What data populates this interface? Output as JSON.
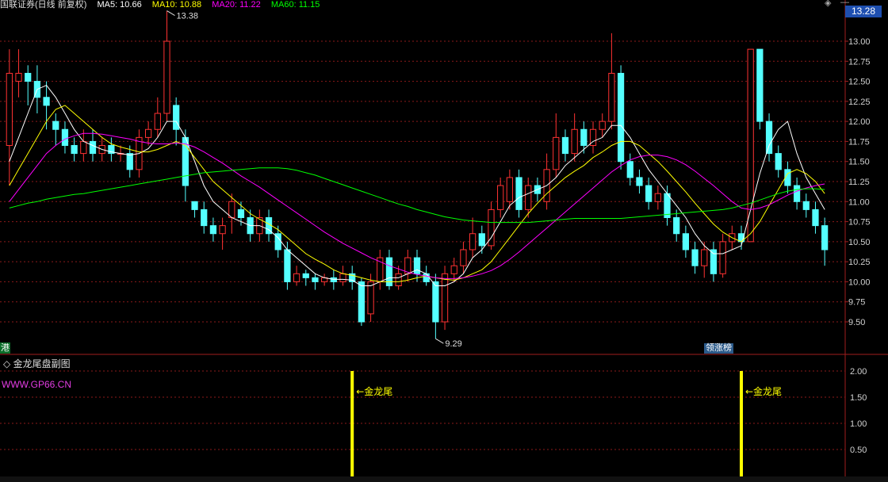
{
  "header": {
    "stock_name": "国联证券(日线 前复权)",
    "ma5": "MA5: 10.66",
    "ma10": "MA10: 10.88",
    "ma20": "MA20: 11.22",
    "ma60": "MA60: 11.15"
  },
  "current_price": "13.28",
  "high_label": "13.38",
  "low_label": "9.29",
  "left_tag": "港",
  "zt_tag": "领涨榜",
  "sub_title": "金龙尾盘副图",
  "sub_url": "WWW.GP66.CN",
  "signal_label": "←金龙尾",
  "colors": {
    "up": "#ff3232",
    "down": "#54ffff",
    "ma5": "#ffffff",
    "ma10": "#ffff00",
    "ma20": "#ff00ff",
    "ma60": "#00ff00",
    "signal": "#ffff00",
    "grid": "#8b1a1a"
  },
  "chart_data": [
    {
      "type": "candlestick",
      "title": "国联证券(日线 前复权)",
      "y_ticks": [
        "13.00",
        "12.75",
        "12.50",
        "12.25",
        "12.00",
        "11.75",
        "11.50",
        "11.25",
        "11.00",
        "10.75",
        "10.50",
        "10.25",
        "10.00",
        "9.75",
        "9.50"
      ],
      "ylim": [
        9.2,
        13.45
      ],
      "high": 13.38,
      "low": 9.29,
      "candles": [
        [
          11.7,
          12.6,
          11.2,
          12.9
        ],
        [
          12.5,
          12.6,
          12.3,
          12.9
        ],
        [
          12.6,
          12.5,
          12.2,
          12.7
        ],
        [
          12.5,
          12.3,
          12.1,
          12.7
        ],
        [
          12.3,
          12.2,
          11.9,
          12.5
        ],
        [
          12.0,
          11.9,
          11.7,
          12.1
        ],
        [
          11.9,
          11.7,
          11.6,
          12.0
        ],
        [
          11.7,
          11.6,
          11.5,
          11.8
        ],
        [
          11.6,
          11.75,
          11.5,
          11.9
        ],
        [
          11.75,
          11.6,
          11.5,
          11.9
        ],
        [
          11.6,
          11.7,
          11.5,
          11.8
        ],
        [
          11.7,
          11.6,
          11.5,
          11.8
        ],
        [
          11.6,
          11.6,
          11.5,
          11.7
        ],
        [
          11.6,
          11.4,
          11.3,
          11.7
        ],
        [
          11.4,
          11.8,
          11.3,
          11.9
        ],
        [
          11.8,
          11.9,
          11.7,
          12.0
        ],
        [
          11.9,
          12.1,
          11.8,
          12.3
        ],
        [
          12.1,
          13.0,
          12.0,
          13.38
        ],
        [
          12.2,
          11.9,
          11.7,
          12.3
        ],
        [
          11.8,
          11.2,
          11.0,
          11.9
        ],
        [
          11.0,
          10.9,
          10.8,
          11.0
        ],
        [
          10.9,
          10.7,
          10.6,
          11.0
        ],
        [
          10.7,
          10.6,
          10.5,
          10.8
        ],
        [
          10.6,
          10.7,
          10.4,
          10.8
        ],
        [
          10.8,
          11.0,
          10.6,
          11.1
        ],
        [
          10.9,
          10.8,
          10.7,
          11.0
        ],
        [
          10.8,
          10.6,
          10.5,
          10.9
        ],
        [
          10.6,
          10.8,
          10.5,
          10.9
        ],
        [
          10.8,
          10.6,
          10.5,
          10.9
        ],
        [
          10.6,
          10.4,
          10.3,
          10.7
        ],
        [
          10.4,
          10.0,
          9.9,
          10.5
        ],
        [
          10.0,
          10.1,
          9.95,
          10.2
        ],
        [
          10.1,
          10.05,
          9.95,
          10.15
        ],
        [
          10.05,
          10.0,
          9.9,
          10.1
        ],
        [
          10.0,
          10.05,
          9.95,
          10.1
        ],
        [
          10.05,
          10.0,
          9.9,
          10.15
        ],
        [
          10.0,
          10.1,
          9.95,
          10.2
        ],
        [
          10.1,
          10.0,
          9.9,
          10.2
        ],
        [
          10.0,
          9.5,
          9.45,
          10.05
        ],
        [
          9.6,
          10.0,
          9.5,
          10.1
        ],
        [
          10.0,
          10.3,
          9.9,
          10.4
        ],
        [
          10.3,
          9.95,
          9.9,
          10.4
        ],
        [
          9.95,
          10.1,
          9.9,
          10.2
        ],
        [
          10.1,
          10.3,
          10.0,
          10.4
        ],
        [
          10.3,
          10.1,
          10.0,
          10.4
        ],
        [
          10.1,
          10.0,
          9.95,
          10.2
        ],
        [
          10.0,
          9.5,
          9.29,
          10.1
        ],
        [
          9.5,
          10.1,
          9.4,
          10.2
        ],
        [
          10.1,
          10.2,
          10.0,
          10.3
        ],
        [
          10.2,
          10.4,
          10.1,
          10.5
        ],
        [
          10.4,
          10.6,
          10.3,
          10.8
        ],
        [
          10.6,
          10.45,
          10.35,
          10.7
        ],
        [
          10.45,
          10.9,
          10.4,
          11.0
        ],
        [
          10.9,
          11.2,
          10.8,
          11.3
        ],
        [
          11.0,
          11.3,
          10.9,
          11.4
        ],
        [
          11.3,
          10.9,
          10.8,
          11.4
        ],
        [
          10.9,
          11.2,
          10.8,
          11.3
        ],
        [
          11.2,
          11.1,
          11.0,
          11.3
        ],
        [
          11.0,
          11.4,
          10.9,
          11.6
        ],
        [
          11.4,
          11.8,
          11.3,
          12.1
        ],
        [
          11.8,
          11.6,
          11.5,
          11.9
        ],
        [
          11.6,
          11.9,
          11.5,
          12.1
        ],
        [
          11.9,
          11.7,
          11.6,
          12.0
        ],
        [
          11.7,
          11.9,
          11.6,
          12.0
        ],
        [
          11.9,
          12.0,
          11.8,
          12.1
        ],
        [
          12.0,
          12.6,
          11.9,
          13.1
        ],
        [
          12.6,
          11.5,
          11.4,
          12.7
        ],
        [
          11.5,
          11.3,
          11.2,
          11.6
        ],
        [
          11.3,
          11.2,
          11.1,
          11.4
        ],
        [
          11.2,
          11.0,
          10.9,
          11.3
        ],
        [
          11.0,
          11.1,
          10.9,
          11.2
        ],
        [
          11.1,
          10.8,
          10.7,
          11.2
        ],
        [
          10.8,
          10.6,
          10.5,
          10.9
        ],
        [
          10.6,
          10.4,
          10.3,
          10.7
        ],
        [
          10.4,
          10.2,
          10.1,
          10.5
        ],
        [
          10.2,
          10.4,
          10.05,
          10.5
        ],
        [
          10.4,
          10.1,
          10.0,
          10.5
        ],
        [
          10.1,
          10.5,
          10.05,
          10.6
        ],
        [
          10.5,
          10.6,
          10.4,
          10.7
        ],
        [
          10.6,
          10.5,
          10.4,
          10.7
        ],
        [
          10.5,
          12.9,
          10.5,
          12.9
        ],
        [
          12.9,
          12.0,
          11.9,
          12.9
        ],
        [
          12.0,
          11.6,
          11.5,
          12.1
        ],
        [
          11.6,
          11.4,
          11.3,
          11.7
        ],
        [
          11.4,
          11.2,
          11.1,
          11.5
        ],
        [
          11.2,
          11.0,
          10.9,
          11.3
        ],
        [
          11.0,
          10.9,
          10.8,
          11.1
        ],
        [
          10.9,
          10.7,
          10.6,
          11.0
        ],
        [
          10.7,
          10.4,
          10.2,
          10.8
        ]
      ],
      "ma_series": [
        {
          "name": "MA5",
          "values": [
            11.5,
            11.8,
            12.1,
            12.4,
            12.45,
            12.3,
            12.1,
            11.9,
            11.75,
            11.7,
            11.65,
            11.62,
            11.6,
            11.58,
            11.6,
            11.66,
            11.8,
            12.0,
            12.0,
            11.8,
            11.5,
            11.2,
            11.0,
            10.9,
            10.8,
            10.75,
            10.7,
            10.7,
            10.65,
            10.55,
            10.4,
            10.3,
            10.2,
            10.1,
            10.05,
            10.03,
            10.03,
            10.02,
            9.95,
            9.95,
            10.0,
            10.05,
            10.05,
            10.1,
            10.15,
            10.1,
            9.95,
            9.95,
            10.0,
            10.1,
            10.3,
            10.4,
            10.55,
            10.75,
            10.95,
            11.05,
            11.1,
            11.15,
            11.2,
            11.3,
            11.45,
            11.55,
            11.65,
            11.75,
            11.8,
            11.95,
            11.95,
            11.8,
            11.6,
            11.4,
            11.25,
            11.1,
            10.95,
            10.8,
            10.6,
            10.45,
            10.35,
            10.35,
            10.4,
            10.45,
            10.9,
            11.35,
            11.7,
            11.9,
            12.0,
            11.6,
            11.3,
            11.1,
            10.9
          ]
        },
        {
          "name": "MA10",
          "values": [
            11.2,
            11.4,
            11.6,
            11.8,
            12.0,
            12.15,
            12.2,
            12.1,
            12.0,
            11.9,
            11.8,
            11.72,
            11.68,
            11.65,
            11.62,
            11.62,
            11.65,
            11.7,
            11.75,
            11.7,
            11.55,
            11.4,
            11.25,
            11.15,
            11.05,
            10.95,
            10.85,
            10.78,
            10.72,
            10.65,
            10.55,
            10.45,
            10.35,
            10.28,
            10.22,
            10.15,
            10.1,
            10.08,
            10.05,
            10.02,
            10.0,
            10.0,
            10.0,
            10.02,
            10.05,
            10.07,
            10.05,
            10.03,
            10.02,
            10.05,
            10.1,
            10.15,
            10.25,
            10.4,
            10.55,
            10.7,
            10.85,
            10.98,
            11.1,
            11.2,
            11.3,
            11.38,
            11.45,
            11.55,
            11.62,
            11.7,
            11.75,
            11.75,
            11.7,
            11.6,
            11.5,
            11.38,
            11.25,
            11.12,
            10.98,
            10.85,
            10.72,
            10.62,
            10.55,
            10.5,
            10.6,
            10.75,
            10.95,
            11.15,
            11.35,
            11.4,
            11.35,
            11.25,
            11.1
          ]
        },
        {
          "name": "MA20",
          "values": [
            11.0,
            11.15,
            11.3,
            11.45,
            11.6,
            11.7,
            11.78,
            11.82,
            11.85,
            11.85,
            11.84,
            11.82,
            11.8,
            11.78,
            11.75,
            11.73,
            11.72,
            11.72,
            11.73,
            11.72,
            11.68,
            11.62,
            11.55,
            11.48,
            11.4,
            11.32,
            11.25,
            11.18,
            11.1,
            11.02,
            10.94,
            10.86,
            10.78,
            10.7,
            10.62,
            10.55,
            10.48,
            10.42,
            10.36,
            10.3,
            10.25,
            10.2,
            10.16,
            10.12,
            10.09,
            10.07,
            10.05,
            10.04,
            10.04,
            10.05,
            10.07,
            10.1,
            10.14,
            10.2,
            10.28,
            10.37,
            10.47,
            10.57,
            10.67,
            10.77,
            10.87,
            10.97,
            11.07,
            11.17,
            11.27,
            11.37,
            11.45,
            11.52,
            11.56,
            11.58,
            11.58,
            11.56,
            11.52,
            11.46,
            11.38,
            11.29,
            11.2,
            11.1,
            11.0,
            10.92,
            10.9,
            10.92,
            10.96,
            11.02,
            11.08,
            11.13,
            11.17,
            11.2,
            11.22
          ]
        },
        {
          "name": "MA60",
          "values": [
            10.92,
            10.95,
            10.98,
            11.0,
            11.03,
            11.05,
            11.07,
            11.09,
            11.1,
            11.12,
            11.14,
            11.16,
            11.18,
            11.2,
            11.22,
            11.24,
            11.26,
            11.28,
            11.3,
            11.32,
            11.34,
            11.36,
            11.37,
            11.38,
            11.39,
            11.4,
            11.41,
            11.42,
            11.42,
            11.42,
            11.41,
            11.39,
            11.36,
            11.33,
            11.29,
            11.25,
            11.21,
            11.17,
            11.13,
            11.09,
            11.05,
            11.01,
            10.97,
            10.94,
            10.9,
            10.87,
            10.84,
            10.81,
            10.79,
            10.77,
            10.76,
            10.75,
            10.74,
            10.74,
            10.74,
            10.74,
            10.74,
            10.75,
            10.76,
            10.77,
            10.78,
            10.79,
            10.79,
            10.79,
            10.79,
            10.79,
            10.79,
            10.8,
            10.81,
            10.82,
            10.83,
            10.84,
            10.85,
            10.86,
            10.87,
            10.88,
            10.89,
            10.9,
            10.92,
            10.95,
            10.98,
            11.02,
            11.06,
            11.1,
            11.13,
            11.15,
            11.16,
            11.16,
            11.15
          ]
        }
      ]
    },
    {
      "type": "bar",
      "title": "金龙尾盘副图",
      "y_ticks": [
        "2.00",
        "1.50",
        "1.00",
        "0.50"
      ],
      "ylim": [
        0,
        2.1
      ],
      "signals": [
        {
          "index": 37,
          "value": 2,
          "label": "←金龙尾"
        },
        {
          "index": 79,
          "value": 2,
          "label": "←金龙尾"
        }
      ]
    }
  ]
}
